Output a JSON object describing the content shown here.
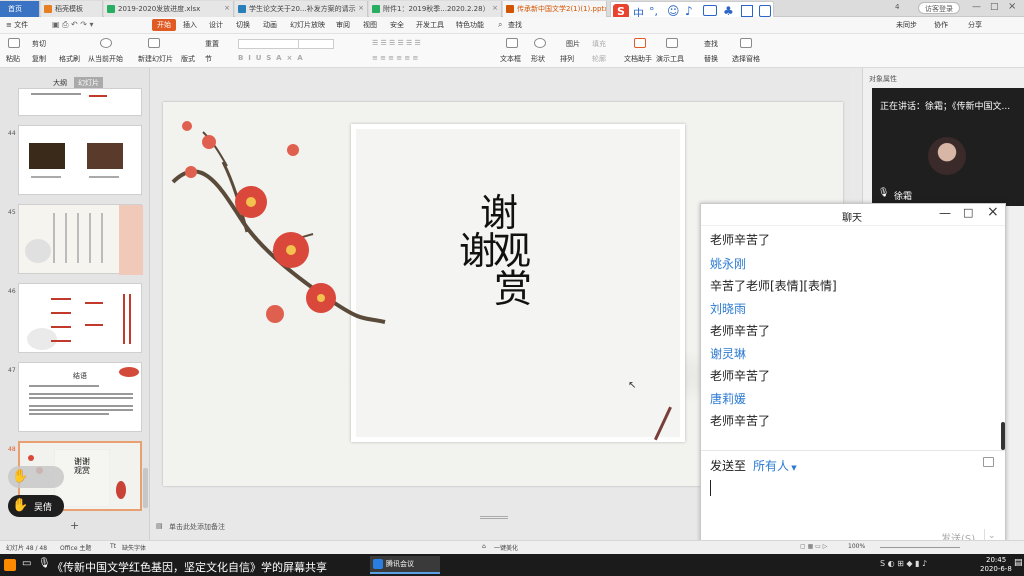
{
  "tabs": [
    {
      "label": "首页",
      "color": "#c0392b"
    },
    {
      "label": "稻壳模板",
      "color": "#e67e22"
    },
    {
      "label": "2019-2020发放进度.xlsx",
      "color": "#27ae60"
    },
    {
      "label": "学生论文关于20...补发方案的请示",
      "color": "#2980b9"
    },
    {
      "label": "附件1：2019秋季...2020.2.28）",
      "color": "#27ae60"
    },
    {
      "label": "传承新中国文学2(1)(1).pptx",
      "color": "#d35400"
    }
  ],
  "top_right": {
    "login": "访客登录",
    "count": "4"
  },
  "menu": {
    "file": "≡ 文件",
    "start": "开始",
    "insert": "插入",
    "design": "设计",
    "transition": "切换",
    "animation": "动画",
    "slideshow": "幻灯片放映",
    "review": "审阅",
    "view": "视图",
    "security": "安全",
    "developer": "开发工具",
    "features": "特色功能",
    "search": "查找",
    "sync": "未同步",
    "collab": "协作",
    "share": "分享"
  },
  "ribbon": {
    "paste": "粘贴",
    "cut": "剪切",
    "copy": "复制",
    "format_painter": "格式刷",
    "from_current": "从当前开始",
    "new_slide": "新建幻灯片",
    "layout": "版式",
    "section": "节",
    "reset": "重置",
    "textbox": "文本框",
    "shape": "形状",
    "arrange": "排列",
    "picture": "图片",
    "fill": "填充",
    "outline": "轮廓",
    "doc_assistant": "文档助手",
    "present_tools": "演示工具",
    "find": "查找",
    "replace": "替换",
    "select_pane": "选择窗格"
  },
  "panel_tabs": {
    "outline": "大纲",
    "slides": "幻灯片"
  },
  "thumbs": [
    {
      "num": "44"
    },
    {
      "num": "45"
    },
    {
      "num": "46"
    },
    {
      "num": "47",
      "title": "结语"
    },
    {
      "num": "48",
      "text": "谢谢观赏"
    }
  ],
  "slide": {
    "line1": "谢",
    "line2": "谢观",
    "line3": "赏"
  },
  "notes_placeholder": "单击此处添加备注",
  "object_props": "对象属性",
  "video": {
    "speaking": "正在讲话：徐霜；《传新中国文...",
    "name": "徐霜"
  },
  "chat": {
    "title": "聊天",
    "messages": [
      {
        "name": "",
        "text": "老师辛苦了"
      },
      {
        "name": "姚永刚",
        "text": "辛苦了老师[表情][表情]"
      },
      {
        "name": "刘晓雨",
        "text": "老师辛苦了"
      },
      {
        "name": "谢灵琳",
        "text": "老师辛苦了"
      },
      {
        "name": "唐莉媛",
        "text": "老师辛苦了"
      }
    ],
    "send_to": "发送至",
    "recipient": "所有人",
    "send_button": "发送(S)"
  },
  "raise_hand": {
    "name": "吴倩"
  },
  "status": {
    "slide": "幻灯片 48 / 48",
    "theme": "Office 主题",
    "font": "缺失字体",
    "beautify": "一键美化",
    "zoom": "100%"
  },
  "taskbar": {
    "share_title": "《传新中国文学红色基因，坚定文化自信》学的屏幕共享",
    "app": "腾讯会议",
    "time": "20:45",
    "date": "2020-6-8"
  }
}
